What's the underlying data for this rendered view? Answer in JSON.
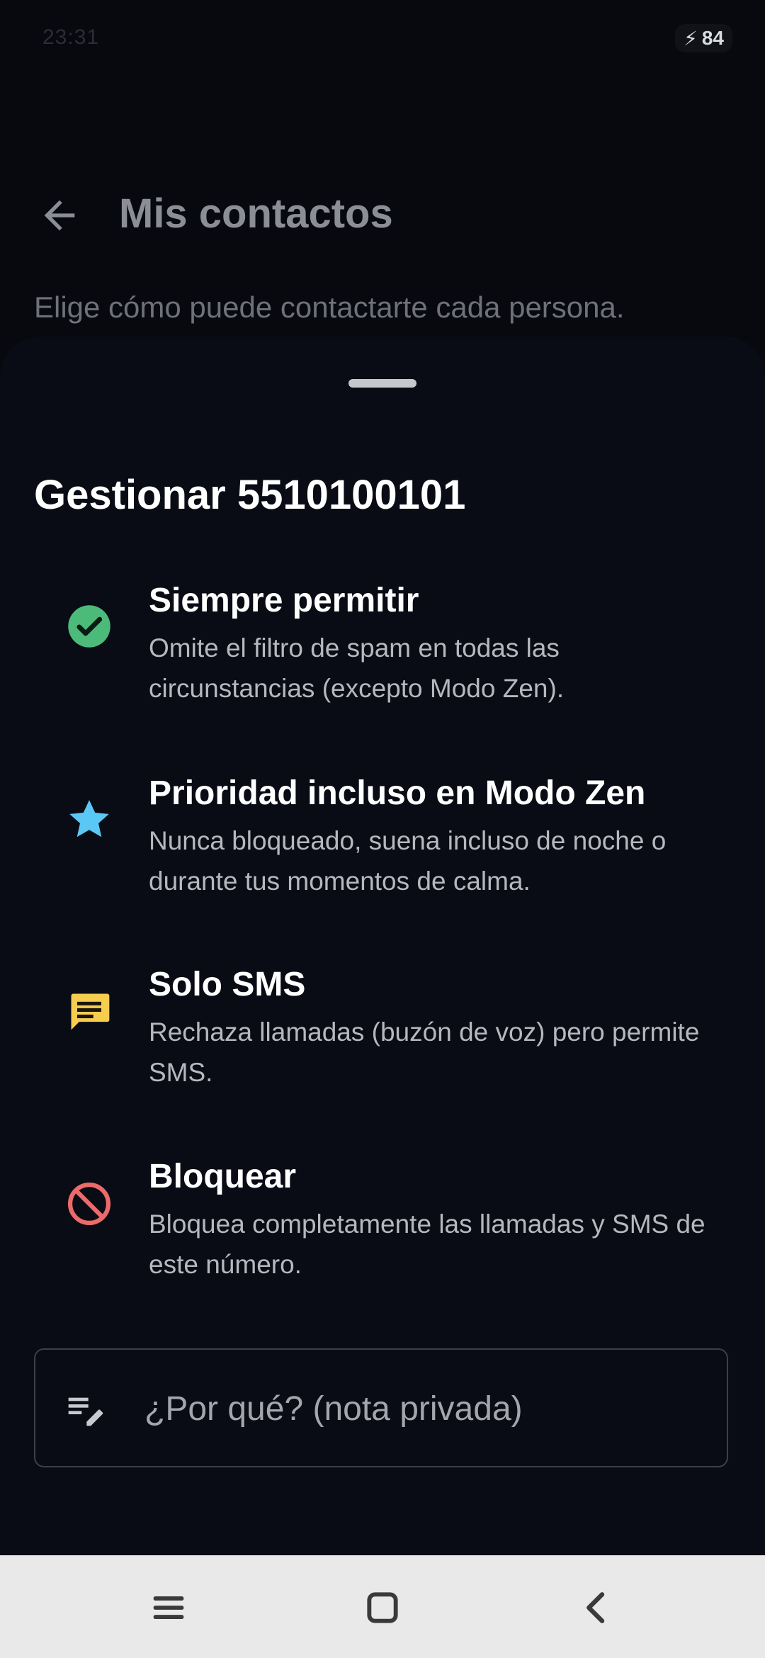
{
  "status_bar": {
    "time": "23:31",
    "battery": "84"
  },
  "app_bar": {
    "title": "Mis contactos",
    "back_icon": "arrow-back-icon"
  },
  "subtitle": "Elige cómo puede contactarte cada persona.",
  "sheet": {
    "title": "Gestionar 5510100101",
    "options": [
      {
        "icon": "check-circle-icon",
        "icon_color": "#4cbb7a",
        "title": "Siempre permitir",
        "description": "Omite el filtro de spam en todas las circunstancias (excepto Modo Zen)."
      },
      {
        "icon": "star-icon",
        "icon_color": "#5ac8f5",
        "title": "Prioridad incluso en Modo Zen",
        "description": "Nunca bloqueado, suena incluso de noche o durante tus momentos de calma."
      },
      {
        "icon": "sms-icon",
        "icon_color": "#f7cd4f",
        "title": "Solo SMS",
        "description": "Rechaza llamadas (buzón de voz) pero permite SMS."
      },
      {
        "icon": "block-icon",
        "icon_color": "#ec6a6a",
        "title": "Bloquear",
        "description": "Bloquea completamente las llamadas y SMS de este número."
      }
    ],
    "note_field": {
      "icon": "edit-note-icon",
      "placeholder": "¿Por qué? (nota privada)"
    }
  },
  "nav_bar": {
    "buttons": [
      "menu-icon",
      "home-square-icon",
      "back-chevron-icon"
    ]
  }
}
